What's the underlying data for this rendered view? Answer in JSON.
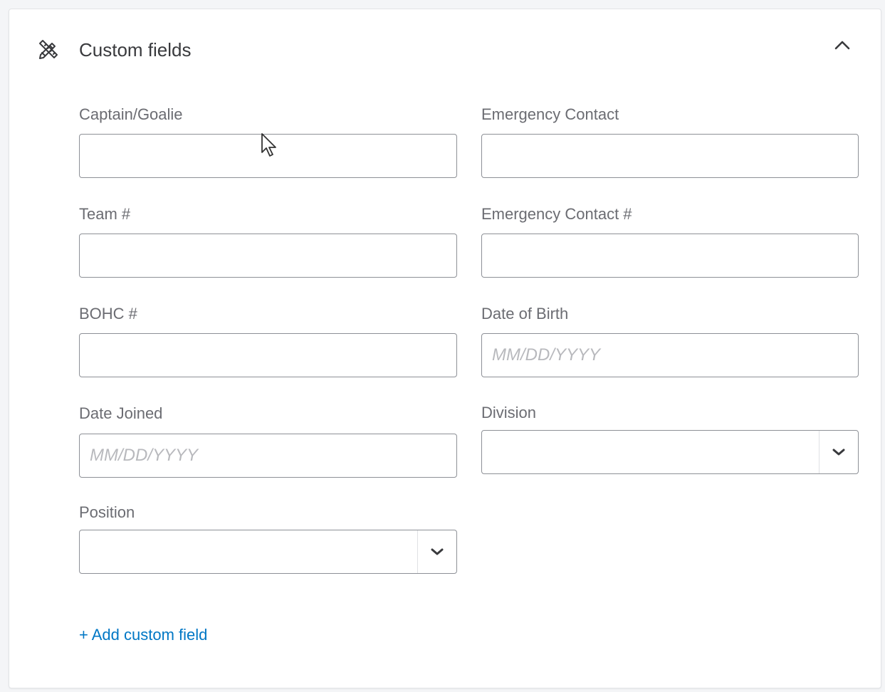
{
  "section": {
    "title": "Custom fields",
    "icon": "tools-icon",
    "collapse_icon": "chevron-up-icon"
  },
  "fields": {
    "captain_goalie": {
      "label": "Captain/Goalie",
      "value": "",
      "placeholder": ""
    },
    "emergency_contact": {
      "label": "Emergency Contact",
      "value": "",
      "placeholder": ""
    },
    "team_number": {
      "label": "Team #",
      "value": "",
      "placeholder": ""
    },
    "emergency_contact_number": {
      "label": "Emergency Contact #",
      "value": "",
      "placeholder": ""
    },
    "bohc_number": {
      "label": "BOHC #",
      "value": "",
      "placeholder": ""
    },
    "date_of_birth": {
      "label": "Date of Birth",
      "value": "",
      "placeholder": "MM/DD/YYYY"
    },
    "date_joined": {
      "label": "Date Joined",
      "value": "",
      "placeholder": "MM/DD/YYYY"
    },
    "division": {
      "label": "Division",
      "selected": ""
    },
    "position": {
      "label": "Position",
      "selected": ""
    }
  },
  "add_custom_field": {
    "label": "+ Add custom field"
  },
  "colors": {
    "link": "#0077c5",
    "label": "#6b6c72",
    "border": "#8d9096",
    "title": "#393a3d"
  }
}
